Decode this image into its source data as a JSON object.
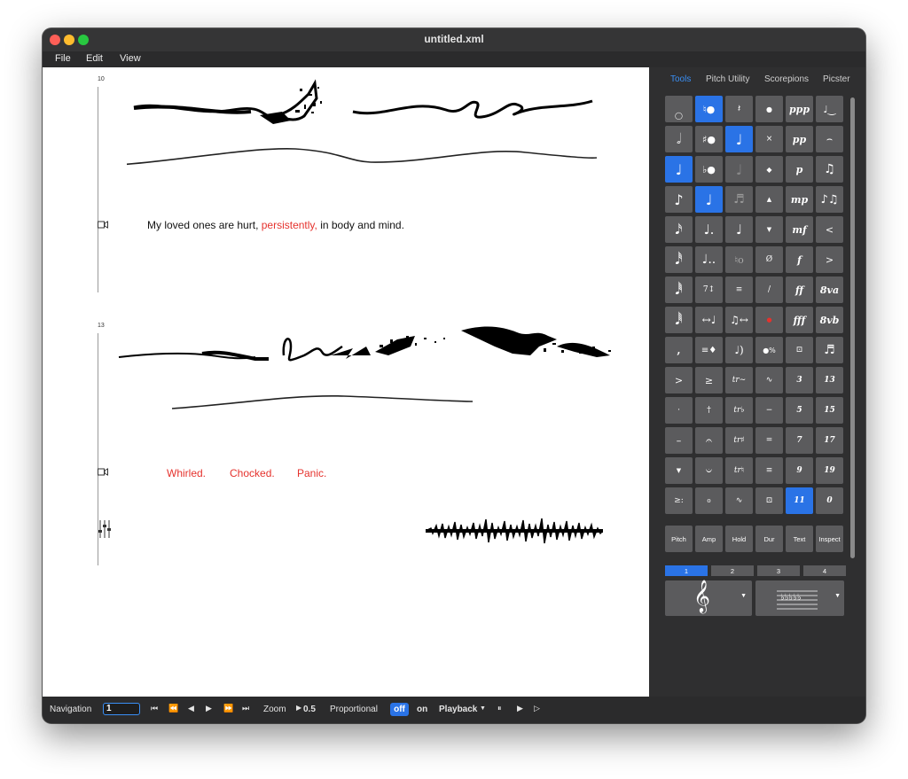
{
  "window": {
    "title": "untitled.xml"
  },
  "menu": {
    "items": [
      "File",
      "Edit",
      "View"
    ]
  },
  "score": {
    "systems": [
      {
        "measure": "10"
      },
      {
        "measure": "13"
      }
    ],
    "lyrics1": {
      "before": "My loved ones are hurt, ",
      "highlight": "persistently,",
      "after": " in body and mind."
    },
    "lyrics2": [
      "Whirled.",
      "Chocked.",
      "Panic."
    ]
  },
  "panel": {
    "tabs": [
      "Tools",
      "Pitch Utility",
      "Scorepions",
      "Picster"
    ],
    "active_tab": "Tools",
    "dynamics": [
      "ppp",
      "pp",
      "p",
      "mp",
      "mf",
      "f",
      "ff",
      "fff"
    ],
    "numbers": [
      "3",
      "5",
      "7",
      "9",
      "11",
      "13",
      "15",
      "17",
      "19",
      "0"
    ],
    "octave_marks": [
      "8va",
      "8vb"
    ],
    "buttons": [
      "Pitch",
      "Amp",
      "Hold",
      "Dur",
      "Text",
      "Inspect"
    ],
    "pages": [
      "1",
      "2",
      "3",
      "4"
    ],
    "active_page": "1",
    "colors": {
      "selected": "#2a73e6",
      "cell": "#5b5b5d",
      "accent_red": "#e5322d"
    }
  },
  "navbar": {
    "navigation_label": "Navigation",
    "measure_value": "1",
    "zoom_label": "Zoom",
    "zoom_value": "0.5",
    "proportional_label": "Proportional",
    "off_label": "off",
    "on_label": "on",
    "playback_label": "Playback"
  }
}
